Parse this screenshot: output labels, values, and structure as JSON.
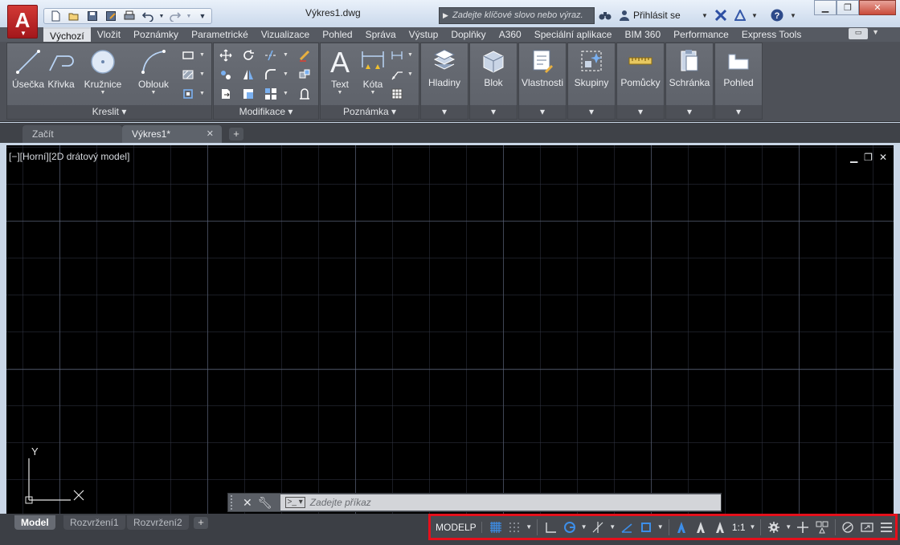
{
  "app": {
    "logo_letter": "A",
    "document_title": "Výkres1.dwg",
    "search_placeholder": "Zadejte klíčové slovo nebo výraz.",
    "sign_in": "Přihlásit se",
    "help": "?"
  },
  "ribbon": {
    "tabs": [
      "Výchozí",
      "Vložit",
      "Poznámky",
      "Parametrické",
      "Vizualizace",
      "Pohled",
      "Správa",
      "Výstup",
      "Doplňky",
      "A360",
      "Speciální aplikace",
      "BIM 360",
      "Performance",
      "Express Tools"
    ],
    "active_tab": "Výchozí",
    "draw": {
      "line": "Úsečka",
      "polyline": "Křivka",
      "circle": "Kružnice",
      "arc": "Oblouk",
      "footer": "Kreslit"
    },
    "modify": {
      "footer": "Modifikace"
    },
    "annotation": {
      "text": "Text",
      "dimension": "Kóta",
      "footer": "Poznámka"
    },
    "panels": {
      "layers": "Hladiny",
      "block": "Blok",
      "properties": "Vlastnosti",
      "groups": "Skupiny",
      "utilities": "Pomůcky",
      "clipboard": "Schránka",
      "view": "Pohled"
    }
  },
  "doc_tabs": {
    "start": "Začít",
    "drawing": "Výkres1*"
  },
  "viewport": {
    "label": "[−][Horní][2D drátový model]",
    "ucs_y": "Y"
  },
  "command_line": {
    "placeholder": "Zadejte příkaz"
  },
  "layout_tabs": [
    "Model",
    "Rozvržení1",
    "Rozvržení2"
  ],
  "status": {
    "modelp": "MODELP",
    "scale": "1:1"
  },
  "colors": {
    "accent_red": "#e5101c",
    "status_blue": "#3d8ee8",
    "viewport_bg": "#000000"
  }
}
